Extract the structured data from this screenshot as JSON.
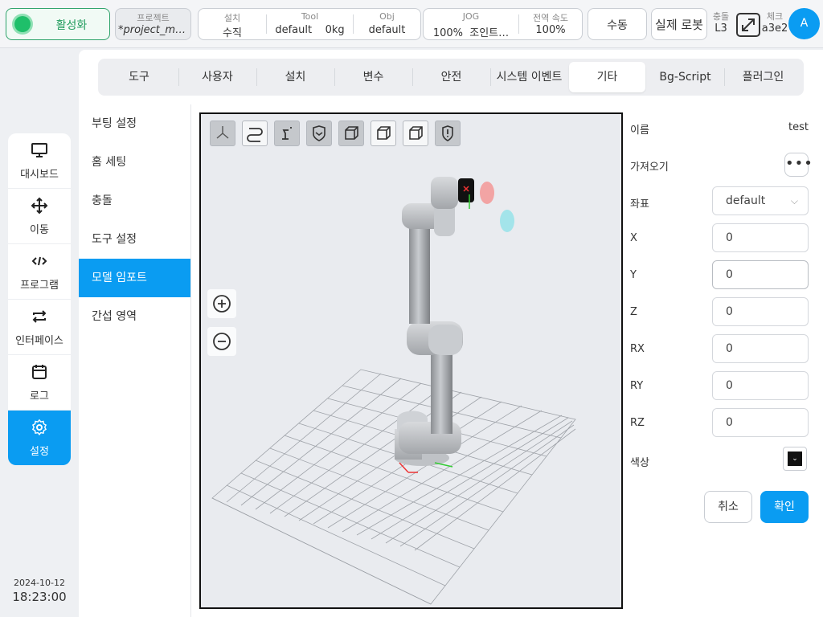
{
  "topbar": {
    "activate_label": "활성화",
    "project_caption": "프로젝트",
    "project_value": "*project_mo…",
    "install_caption": "설치",
    "install_value": "수직",
    "tool_caption": "Tool",
    "tool_value": "default",
    "tool_weight": "0kg",
    "obj_caption": "Obj",
    "obj_value": "default",
    "jog_caption": "JOG",
    "jog_percent": "100%",
    "jog_mode": "조인트…",
    "speed_caption": "전역 속도",
    "speed_value": "100%",
    "manual_label": "수동",
    "real_robot_label": "실제 로봇",
    "collision_caption": "충돌",
    "collision_value": "L3",
    "check_caption": "체크",
    "check_value": "a3e2",
    "avatar_label": "A"
  },
  "leftnav": {
    "items": [
      {
        "label": "대시보드",
        "icon": "monitor-icon"
      },
      {
        "label": "이동",
        "icon": "move-icon"
      },
      {
        "label": "프로그램",
        "icon": "code-icon"
      },
      {
        "label": "인터페이스",
        "icon": "swap-icon"
      },
      {
        "label": "로그",
        "icon": "calendar-icon"
      },
      {
        "label": "설정",
        "icon": "gear-icon"
      }
    ],
    "date": "2024-10-12",
    "time": "18:23:00"
  },
  "tabs": [
    "도구",
    "사용자",
    "설치",
    "변수",
    "안전",
    "시스템 이벤트",
    "기타",
    "Bg-Script",
    "플러그인"
  ],
  "active_tab": "기타",
  "submenu": [
    "부팅 설정",
    "홈 세팅",
    "충돌",
    "도구 설정",
    "모델 임포트",
    "간섭 영역"
  ],
  "active_submenu": "모델 임포트",
  "form": {
    "name_label": "이름",
    "name_value": "test",
    "import_label": "가져오기",
    "import_button": "•••",
    "coord_label": "좌표",
    "coord_value": "default",
    "x_label": "X",
    "x_value": "0",
    "y_label": "Y",
    "y_value": "0",
    "z_label": "Z",
    "z_value": "0",
    "rx_label": "RX",
    "rx_value": "0",
    "ry_label": "RY",
    "ry_value": "0",
    "rz_label": "RZ",
    "rz_value": "0",
    "color_label": "색상",
    "color_value": "#111111",
    "cancel_label": "취소",
    "ok_label": "확인"
  },
  "colors": {
    "accent": "#0a9cf2",
    "active_green": "#1fbf6a"
  }
}
